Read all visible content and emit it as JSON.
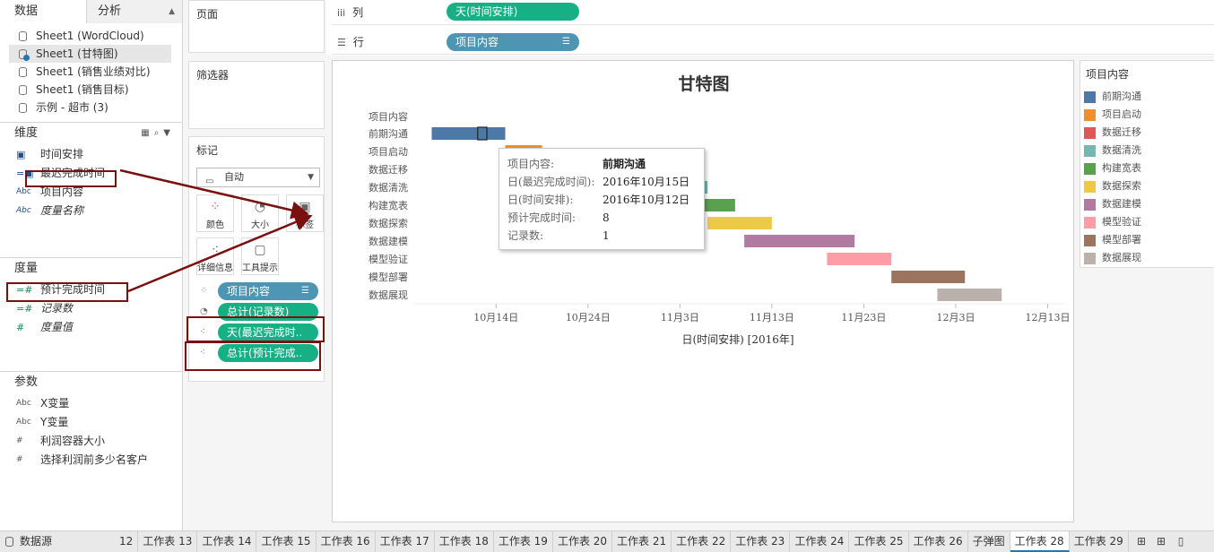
{
  "left": {
    "tabs": [
      "数据",
      "分析"
    ],
    "data_sources": [
      {
        "name": "Sheet1 (WordCloud)",
        "selected": false
      },
      {
        "name": "Sheet1 (甘特图)",
        "selected": true
      },
      {
        "name": "Sheet1 (销售业绩对比)",
        "selected": false
      },
      {
        "name": "Sheet1 (销售目标)",
        "selected": false
      },
      {
        "name": "示例 - 超市 (3)",
        "selected": false
      }
    ],
    "dimensions_title": "维度",
    "dimensions": [
      {
        "label": "时间安排",
        "icon": "calendar-icon"
      },
      {
        "label": "最迟完成时间",
        "icon": "calc-date-icon"
      },
      {
        "label": "项目内容",
        "icon": "abc-icon"
      },
      {
        "label": "度量名称",
        "icon": "abc-icon"
      }
    ],
    "measures_title": "度量",
    "measures": [
      {
        "label": "预计完成时间",
        "icon": "calc-number-icon"
      },
      {
        "label": "记录数",
        "icon": "calc-number-icon"
      },
      {
        "label": "度量值",
        "icon": "number-icon"
      }
    ],
    "params_title": "参数",
    "params": [
      {
        "label": "X变量",
        "icon": "abc-icon"
      },
      {
        "label": "Y变量",
        "icon": "abc-icon"
      },
      {
        "label": "利润容器大小",
        "icon": "number-icon"
      },
      {
        "label": "选择利润前多少名客户",
        "icon": "number-icon"
      }
    ]
  },
  "shelves": {
    "pages": "页面",
    "filters": "筛选器",
    "marks_title": "标记",
    "mark_type": "自动",
    "mark_buttons": [
      "颜色",
      "大小",
      "标签",
      "详细信息",
      "工具提示"
    ],
    "mark_pills": [
      "项目内容",
      "总计(记录数)",
      "天(最迟完成时..",
      "总计(预计完成.."
    ]
  },
  "top": {
    "columns_label": "列",
    "columns_pill": "天(时间安排)",
    "rows_label": "行",
    "rows_pill": "项目内容"
  },
  "chart_data": {
    "type": "gantt",
    "title": "甘特图",
    "row_header": "项目内容",
    "xlabel": "日(时间安排) [2016年]",
    "x_ticks": [
      "10月14日",
      "10月24日",
      "11月3日",
      "11月13日",
      "11月23日",
      "12月3日",
      "12月13日"
    ],
    "x_range": [
      "2016-10-05",
      "2016-12-15"
    ],
    "tasks": [
      {
        "name": "前期沟通",
        "start": "2016-10-07",
        "duration_days": 8,
        "color": "#4e79a7"
      },
      {
        "name": "项目启动",
        "start": "2016-10-15",
        "duration_days": 4,
        "color": "#f28e2b"
      },
      {
        "name": "数据迁移",
        "start": "2016-10-19",
        "duration_days": 8,
        "color": "#e15759"
      },
      {
        "name": "数据清洗",
        "start": "2016-10-26",
        "duration_days": 11,
        "color": "#76b7b2"
      },
      {
        "name": "构建宽表",
        "start": "2016-10-29",
        "duration_days": 11,
        "color": "#59a14f"
      },
      {
        "name": "数据探索",
        "start": "2016-11-06",
        "duration_days": 7,
        "color": "#edc948"
      },
      {
        "name": "数据建模",
        "start": "2016-11-10",
        "duration_days": 12,
        "color": "#b07aa1"
      },
      {
        "name": "模型验证",
        "start": "2016-11-19",
        "duration_days": 7,
        "color": "#ff9da7"
      },
      {
        "name": "模型部署",
        "start": "2016-11-26",
        "duration_days": 8,
        "color": "#9c755f"
      },
      {
        "name": "数据展现",
        "start": "2016-12-01",
        "duration_days": 7,
        "color": "#bab0ac"
      }
    ]
  },
  "tooltip": [
    {
      "k": "项目内容:",
      "v": "前期沟通",
      "bold": true
    },
    {
      "k": "日(最迟完成时间):",
      "v": "2016年10月15日",
      "bold": false
    },
    {
      "k": "日(时间安排):",
      "v": "2016年10月12日",
      "bold": false
    },
    {
      "k": "预计完成时间:",
      "v": "8",
      "bold": false
    },
    {
      "k": "记录数:",
      "v": "1",
      "bold": false
    }
  ],
  "legend": {
    "title": "项目内容",
    "items": [
      {
        "label": "前期沟通",
        "color": "#4e79a7"
      },
      {
        "label": "项目启动",
        "color": "#f28e2b"
      },
      {
        "label": "数据迁移",
        "color": "#e15759"
      },
      {
        "label": "数据清洗",
        "color": "#76b7b2"
      },
      {
        "label": "构建宽表",
        "color": "#59a14f"
      },
      {
        "label": "数据探索",
        "color": "#edc948"
      },
      {
        "label": "数据建模",
        "color": "#b07aa1"
      },
      {
        "label": "模型验证",
        "color": "#ff9da7"
      },
      {
        "label": "模型部署",
        "color": "#9c755f"
      },
      {
        "label": "数据展现",
        "color": "#bab0ac"
      }
    ]
  },
  "tabbar": {
    "datasource": "数据源",
    "sheets": [
      "12",
      "工作表 13",
      "工作表 14",
      "工作表 15",
      "工作表 16",
      "工作表 17",
      "工作表 18",
      "工作表 19",
      "工作表 20",
      "工作表 21",
      "工作表 22",
      "工作表 23",
      "工作表 24",
      "工作表 25",
      "工作表 26",
      "子弹图",
      "工作表 28",
      "工作表 29"
    ],
    "active": "工作表 28"
  }
}
